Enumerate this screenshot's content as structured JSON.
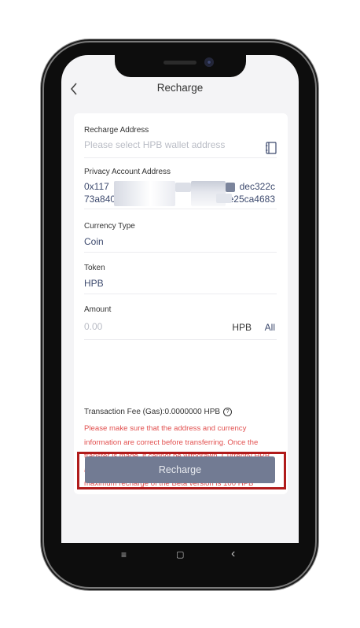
{
  "header": {
    "title": "Recharge"
  },
  "form": {
    "recharge_address": {
      "label": "Recharge Address",
      "placeholder": "Please select HPB wallet address"
    },
    "privacy_address": {
      "label": "Privacy Account Address",
      "line1_start": "0x117",
      "line1_end": "dec322c",
      "line2_start": "73a840",
      "line2_end": "e25ca4683"
    },
    "currency_type": {
      "label": "Currency Type",
      "value": "Coin"
    },
    "token": {
      "label": "Token",
      "value": "HPB"
    },
    "amount": {
      "label": "Amount",
      "placeholder": "0.00",
      "unit": "HPB",
      "all_label": "All"
    }
  },
  "fee_text": "Transaction Fee (Gas):0.0000000 HPB",
  "help_glyph": "?",
  "warning": "Please make sure that the address and currency information are correct before transferring. Once the transfer is made, it cannot be withdrawn. Currently HPB and privacy coins have a fixed 1:1 ratio, and the maximum recharge of the Beta version is 100 HPB",
  "recharge_button": "Recharge",
  "nav": {
    "menu": "≡",
    "home": "▢",
    "back": "‹"
  },
  "colors": {
    "accent": "#3d4a6e",
    "warning": "#e2504f",
    "button": "#727b93",
    "highlight": "#b01b1b"
  }
}
